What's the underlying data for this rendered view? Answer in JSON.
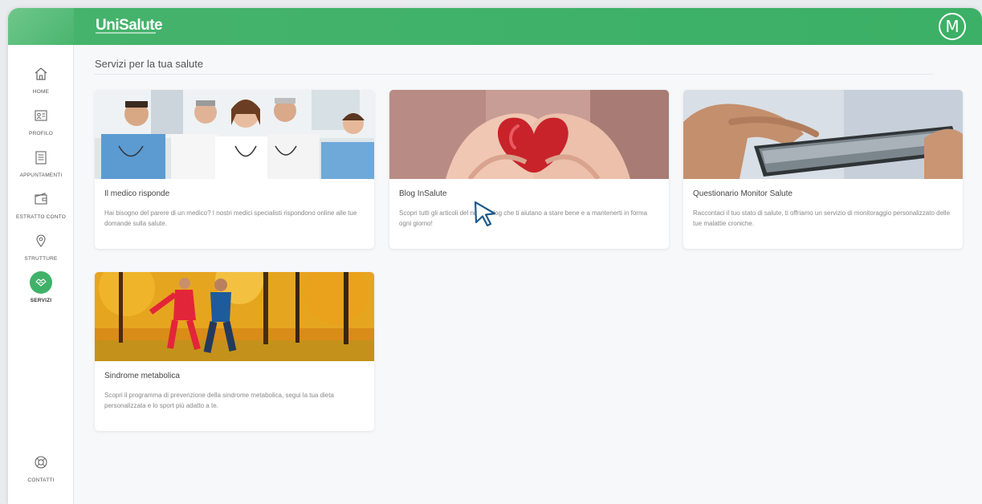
{
  "header": {
    "logo": "UniSalute",
    "avatar_letter": "M"
  },
  "sidebar": {
    "items": [
      {
        "label": "HOME",
        "icon": "home-icon"
      },
      {
        "label": "PROFILO",
        "icon": "profile-card-icon"
      },
      {
        "label": "APPUNTAMENTI",
        "icon": "calendar-list-icon"
      },
      {
        "label": "ESTRATTO CONTO",
        "icon": "wallet-icon"
      },
      {
        "label": "STRUTTURE",
        "icon": "location-pin-icon"
      },
      {
        "label": "SERVIZI",
        "icon": "services-icon",
        "active": true
      }
    ],
    "footer": {
      "label": "CONTATTI",
      "icon": "lifebuoy-icon"
    }
  },
  "main": {
    "title": "Servizi per la tua salute",
    "cards": [
      {
        "title": "Il medico risponde",
        "description": "Hai bisogno del parere di un medico? I nostri medici specialisti rispondono online alle tue domande sulla salute."
      },
      {
        "title": "Blog InSalute",
        "description": "Scopri tutti gli articoli del nostro blog che ti aiutano a stare bene e a mantenerti in forma ogni giorno!"
      },
      {
        "title": "Questionario Monitor Salute",
        "description": "Raccontaci il tuo stato di salute, ti offriamo un servizio di monitoraggio personalizzato delle tue malattie croniche."
      },
      {
        "title": "Sindrome metabolica",
        "description": "Scopri il programma di prevenzione della sindrome metabolica, segui la tua dieta personalizzata e lo sport più adatto a te."
      }
    ]
  },
  "colors": {
    "brand_green": "#3fb168",
    "cursor_blue": "#1f5b8a"
  }
}
